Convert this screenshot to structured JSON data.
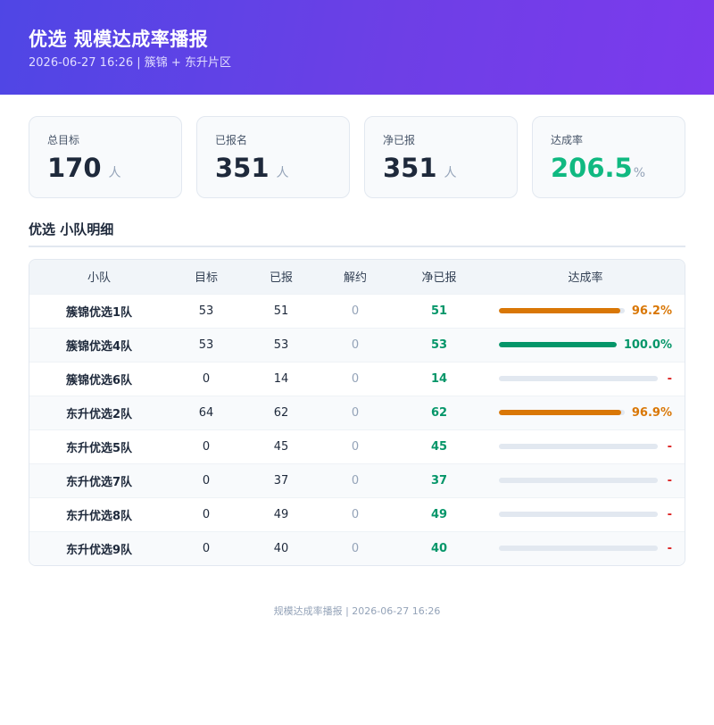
{
  "header": {
    "title": "优选 规模达成率播报",
    "subtitle": "2026-06-27 16:26 | 簇锦 + 东升片区"
  },
  "cards": [
    {
      "label": "总目标",
      "value": "170",
      "unit": "人",
      "accent": ""
    },
    {
      "label": "已报名",
      "value": "351",
      "unit": "人",
      "accent": ""
    },
    {
      "label": "净已报",
      "value": "351",
      "unit": "人",
      "accent": ""
    },
    {
      "label": "达成率",
      "value": "206.5",
      "unit": "%",
      "accent": "#10b981"
    }
  ],
  "section_title": "优选 小队明细",
  "table": {
    "headers": [
      "小队",
      "目标",
      "已报",
      "解约",
      "净已报",
      "达成率"
    ],
    "rows": [
      {
        "team": "簇锦优选1队",
        "target": "53",
        "reported": "51",
        "cancelled": "0",
        "net": "51",
        "rate_text": "96.2%",
        "rate": 0.962,
        "color": "#d97706"
      },
      {
        "team": "簇锦优选4队",
        "target": "53",
        "reported": "53",
        "cancelled": "0",
        "net": "53",
        "rate_text": "100.0%",
        "rate": 1.0,
        "color": "#059669"
      },
      {
        "team": "簇锦优选6队",
        "target": "0",
        "reported": "14",
        "cancelled": "0",
        "net": "14",
        "rate_text": "-",
        "rate": 0,
        "color": "#dc2626"
      },
      {
        "team": "东升优选2队",
        "target": "64",
        "reported": "62",
        "cancelled": "0",
        "net": "62",
        "rate_text": "96.9%",
        "rate": 0.969,
        "color": "#d97706"
      },
      {
        "team": "东升优选5队",
        "target": "0",
        "reported": "45",
        "cancelled": "0",
        "net": "45",
        "rate_text": "-",
        "rate": 0,
        "color": "#dc2626"
      },
      {
        "team": "东升优选7队",
        "target": "0",
        "reported": "37",
        "cancelled": "0",
        "net": "37",
        "rate_text": "-",
        "rate": 0,
        "color": "#dc2626"
      },
      {
        "team": "东升优选8队",
        "target": "0",
        "reported": "49",
        "cancelled": "0",
        "net": "49",
        "rate_text": "-",
        "rate": 0,
        "color": "#dc2626"
      },
      {
        "team": "东升优选9队",
        "target": "0",
        "reported": "40",
        "cancelled": "0",
        "net": "40",
        "rate_text": "-",
        "rate": 0,
        "color": "#dc2626"
      }
    ]
  },
  "footer": "规模达成率播报 | 2026-06-27 16:26"
}
